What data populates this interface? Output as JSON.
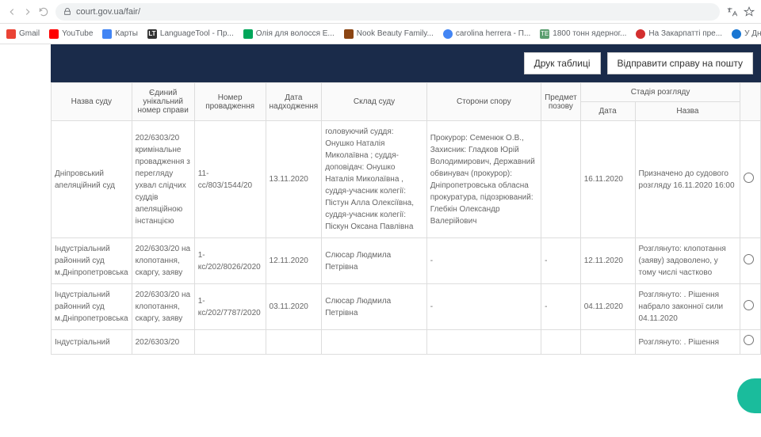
{
  "browser": {
    "url": "court.gov.ua/fair/"
  },
  "bookmarks": [
    {
      "label": "Gmail",
      "cls": "bm-gmail"
    },
    {
      "label": "YouTube",
      "cls": "bm-yt"
    },
    {
      "label": "Карты",
      "cls": "bm-maps"
    },
    {
      "label": "LanguageTool - Пр...",
      "cls": "bm-lt",
      "text": "LT"
    },
    {
      "label": "Олія для волосся E...",
      "cls": "bm-green"
    },
    {
      "label": "Nook Beauty Family...",
      "cls": "bm-nook"
    },
    {
      "label": "carolina herrera - П...",
      "cls": "bm-google"
    },
    {
      "label": "1800 тонн ядерног...",
      "cls": "bm-te",
      "text": "ТЕ"
    },
    {
      "label": "На Закарпатті пре...",
      "cls": "bm-red"
    },
    {
      "label": "У Дніпрі діти, позб...",
      "cls": "bm-blue"
    }
  ],
  "actions": {
    "print": "Друк таблиці",
    "send": "Відправити справу на пошту"
  },
  "headers": {
    "court": "Назва суду",
    "unique": "Єдиний унікальний номер справи",
    "caseNo": "Номер провадження",
    "date": "Дата надходження",
    "staff": "Склад суду",
    "parties": "Сторони спору",
    "subject": "Предмет позову",
    "stage": "Стадія розгляду",
    "stageDate": "Дата",
    "stageName": "Назва"
  },
  "rows": [
    {
      "court": "Дніпровський апеляційний суд",
      "unique": "202/6303/20 кримінальне провадження з перегляду ухвал слідчих суддів апеляційною інстанцією",
      "caseNo": "11-сс/803/1544/20",
      "date": "13.11.2020",
      "staff": "головуючий суддя: Онушко Наталія Миколаївна ; суддя-доповідач: Онушко Наталія Миколаївна , суддя-учасник колегії: Пістун Алла Олексіївна, суддя-учасник колегії: Піскун Оксана Павлівна",
      "parties": "Прокурор: Семенюк О.В., Захисник: Гладков Юрій Володимирович, Державний обвинувач (прокурор): Дніпропетровська обласна прокуратура, підозрюваний: Глебкін Олександр Валерійович",
      "subject": "",
      "stageDate": "16.11.2020",
      "stageName": "Призначено до судового розгляду 16.11.2020 16:00"
    },
    {
      "court": "Індустріальний районний суд м.Дніпропетровська",
      "unique": "202/6303/20 на клопотання, скаргу, заяву",
      "caseNo": "1-кс/202/8026/2020",
      "date": "12.11.2020",
      "staff": "Слюсар Людмила Петрівна",
      "parties": "-",
      "subject": "-",
      "stageDate": "12.11.2020",
      "stageName": "Розглянуто: клопотання (заяву) задоволено, у тому числі частково"
    },
    {
      "court": "Індустріальний районний суд м.Дніпропетровська",
      "unique": "202/6303/20 на клопотання, скаргу, заяву",
      "caseNo": "1-кс/202/7787/2020",
      "date": "03.11.2020",
      "staff": "Слюсар Людмила Петрівна",
      "parties": "-",
      "subject": "-",
      "stageDate": "04.11.2020",
      "stageName": "Розглянуто: . Рішення набрало законної сили 04.11.2020"
    },
    {
      "court": "Індустріальний",
      "unique": "202/6303/20",
      "caseNo": "",
      "date": "",
      "staff": "",
      "parties": "",
      "subject": "",
      "stageDate": "",
      "stageName": "Розглянуто: . Рішення"
    }
  ]
}
